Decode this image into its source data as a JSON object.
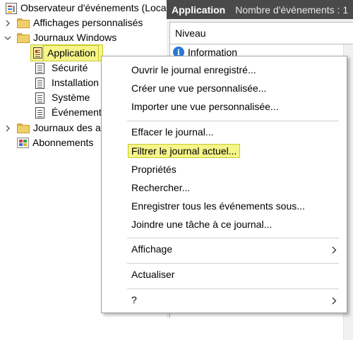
{
  "tree": {
    "root_label": "Observateur d'événements (Loca",
    "items": [
      {
        "label": "Affichages personnalisés"
      },
      {
        "label": "Journaux Windows"
      },
      {
        "label": "Application"
      },
      {
        "label": "Sécurité"
      },
      {
        "label": "Installation"
      },
      {
        "label": "Système"
      },
      {
        "label": "Événement"
      },
      {
        "label": "Journaux des a"
      },
      {
        "label": "Abonnements"
      }
    ]
  },
  "header": {
    "title": "Application",
    "count": "Nombre d'événements : 1"
  },
  "grid": {
    "column_level": "Niveau",
    "row_level": "Information",
    "info_glyph": "i"
  },
  "menu": {
    "items": [
      {
        "label": "Ouvrir le journal enregistré..."
      },
      {
        "label": "Créer une vue personnalisée..."
      },
      {
        "label": "Importer une vue personnalisée..."
      },
      {
        "label": "Effacer le journal..."
      },
      {
        "label": "Filtrer le journal actuel..."
      },
      {
        "label": "Propriétés"
      },
      {
        "label": "Rechercher..."
      },
      {
        "label": "Enregistrer tous les événements sous..."
      },
      {
        "label": "Joindre une tâche à ce journal..."
      },
      {
        "label": "Affichage"
      },
      {
        "label": "Actualiser"
      },
      {
        "label": "?"
      }
    ]
  },
  "colors": {
    "highlight": "#f5f58a",
    "header_bg": "#4a4a4a",
    "info_blue": "#2a78d4"
  }
}
